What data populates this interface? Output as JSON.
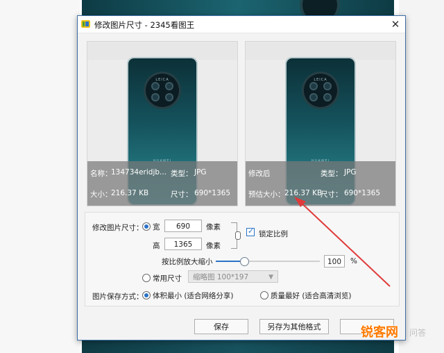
{
  "window": {
    "title": "修改图片尺寸 - 2345看图王"
  },
  "original": {
    "name_label": "名称：",
    "name_value": "134734eridjb...",
    "type_label": "类型：",
    "type_value": "JPG",
    "size_label": "大小：",
    "size_value": "216.37 KB",
    "dim_label": "尺寸：",
    "dim_value": "690*1365"
  },
  "modified": {
    "title": "修改后",
    "type_label": "类型：",
    "type_value": "JPG",
    "est_label": "预估大小：",
    "est_value": "216.37 KB",
    "dim_label": "尺寸：",
    "dim_value": "690*1365"
  },
  "phone": {
    "brand_top": "LEICA",
    "brand_bottom": "HUAWEI"
  },
  "form": {
    "size_label": "修改图片尺寸：",
    "width_label": "宽",
    "width_value": "690",
    "width_unit": "像素",
    "height_label": "高",
    "height_value": "1365",
    "height_unit": "像素",
    "lock_label": "锁定比例",
    "lock_checked": true,
    "scale_label": "按比例放大缩小",
    "scale_value": "100",
    "scale_unit": "%",
    "scale_percent": 0.27,
    "common_label": "常用尺寸",
    "common_select": "缩略图 100*197",
    "save_mode_label": "图片保存方式：",
    "mode_small": "体积最小 (适合网络分享)",
    "mode_best": "质量最好 (适合高清浏览)"
  },
  "buttons": {
    "save": "保存",
    "save_as": "另存为其他格式"
  },
  "watermark": {
    "brand": "锐客网",
    "extra": "问答"
  },
  "colors": {
    "accent": "#2a73c7",
    "arrow": "#e03a3a"
  }
}
